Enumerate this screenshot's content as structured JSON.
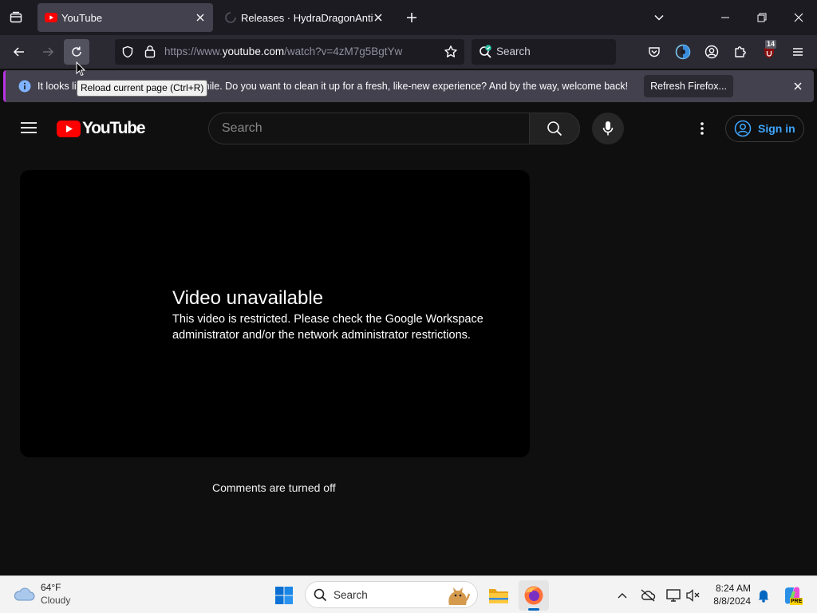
{
  "browser": {
    "tabs": [
      {
        "title": "YouTube",
        "active": true
      },
      {
        "title": "Releases · HydraDragonAntivirus",
        "active": false
      }
    ],
    "url": {
      "prefix": "https://www.",
      "host": "youtube.com",
      "path": "/watch?v=4zM7g5BgtYw"
    },
    "search_placeholder": "Search",
    "extension_badge": "14",
    "notification": {
      "text_start": "It looks lik",
      "text_end": "n a while. Do you want to clean it up for a fresh, like-new experience? And by the way, welcome back!",
      "button_label": "Refresh Firefox..."
    },
    "tooltip": "Reload current page (Ctrl+R)"
  },
  "youtube": {
    "logo_text": "YouTube",
    "search_placeholder": "Search",
    "signin_label": "Sign in",
    "player": {
      "title": "Video unavailable",
      "message": "This video is restricted. Please check the Google Workspace administrator and/or the network administrator restrictions."
    },
    "comments_status": "Comments are turned off"
  },
  "taskbar": {
    "weather": {
      "temp": "64°F",
      "condition": "Cloudy"
    },
    "search_placeholder": "Search",
    "time": "8:24 AM",
    "date": "8/8/2024",
    "copilot_badge": "PRE"
  },
  "colors": {
    "browser_chrome": "#1c1b22",
    "toolbar": "#2b2a33",
    "yt_background": "#0f0f0f",
    "yt_red": "#ff0000",
    "signin_blue": "#3ea6ff",
    "notif_accent": "#b833e1"
  }
}
